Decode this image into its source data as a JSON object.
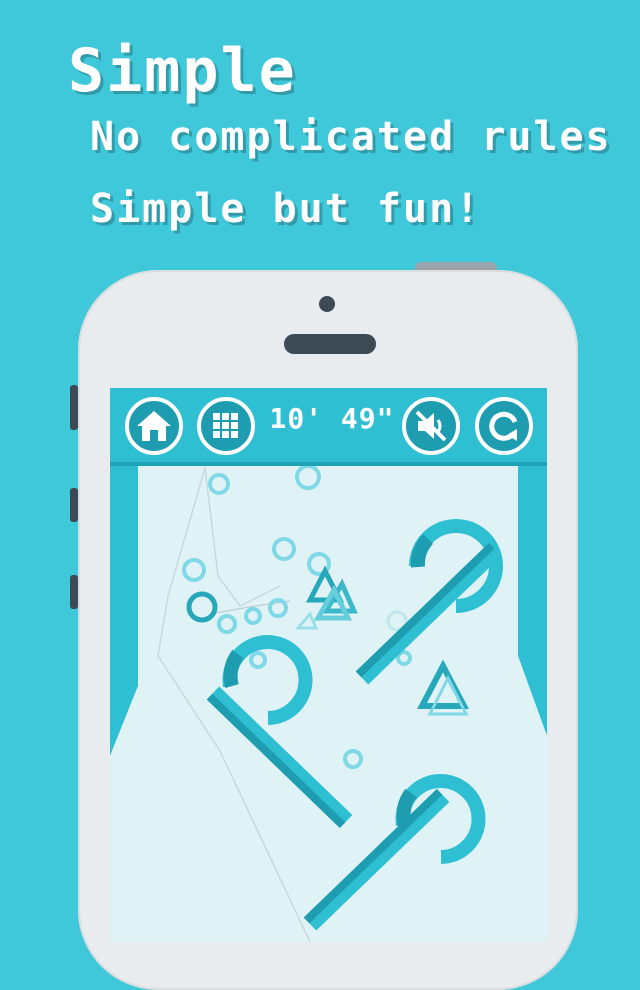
{
  "promo": {
    "title": "Simple",
    "line1": "No complicated rules",
    "line2": "Simple but fun!"
  },
  "game": {
    "timer": "10' 49\"",
    "toolbar": {
      "home": "home-icon",
      "levels": "grid-icon",
      "sound": "sound-muted-icon",
      "restart": "restart-icon"
    }
  },
  "colors": {
    "background": "#3fc7da",
    "accent": "#2fbfd3",
    "accent_dark": "#1e9db0",
    "playfield": "#e6f7fa"
  }
}
